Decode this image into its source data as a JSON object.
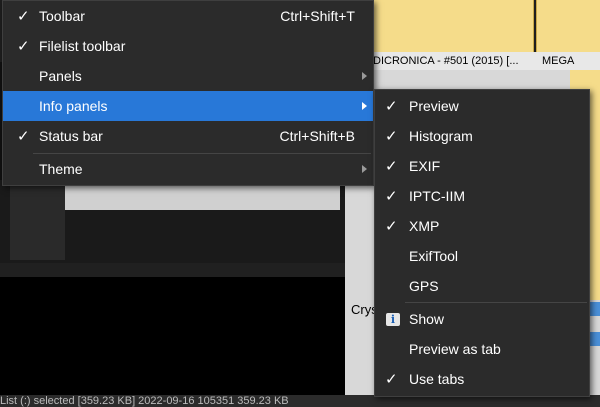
{
  "menu": {
    "items": [
      {
        "label": "Toolbar",
        "checked": true,
        "shortcut": "Ctrl+Shift+T"
      },
      {
        "label": "Filelist toolbar",
        "checked": true,
        "shortcut": ""
      },
      {
        "label": "Panels",
        "checked": false,
        "submenu": true
      },
      {
        "label": "Info panels",
        "checked": false,
        "submenu": true,
        "highlighted": true
      },
      {
        "label": "Status bar",
        "checked": true,
        "shortcut": "Ctrl+Shift+B"
      },
      {
        "label": "Theme",
        "checked": false,
        "submenu": true
      }
    ]
  },
  "submenu": {
    "items": [
      {
        "label": "Preview",
        "checked": true
      },
      {
        "label": "Histogram",
        "checked": true
      },
      {
        "label": "EXIF",
        "checked": true
      },
      {
        "label": "IPTC-IIM",
        "checked": true
      },
      {
        "label": "XMP",
        "checked": true
      },
      {
        "label": "ExifTool",
        "checked": false
      },
      {
        "label": "GPS",
        "checked": false
      },
      {
        "label": "Show",
        "icon": "info-icon"
      },
      {
        "label": "Preview as tab",
        "checked": false
      },
      {
        "label": "Use tabs",
        "checked": true
      }
    ]
  },
  "background": {
    "thumb_caption_1": "DICRONICA - #501 (2015) [...",
    "thumb_caption_2": "MEGA",
    "partial_text": "Crys",
    "status_text": "List (:) selected [359.23 KB]   2022-09-16  105351   359.23 KB"
  },
  "colors": {
    "menu_bg": "#2b2b2b",
    "highlight": "#2878d8",
    "accent_thumb": "#f5dc8a"
  }
}
